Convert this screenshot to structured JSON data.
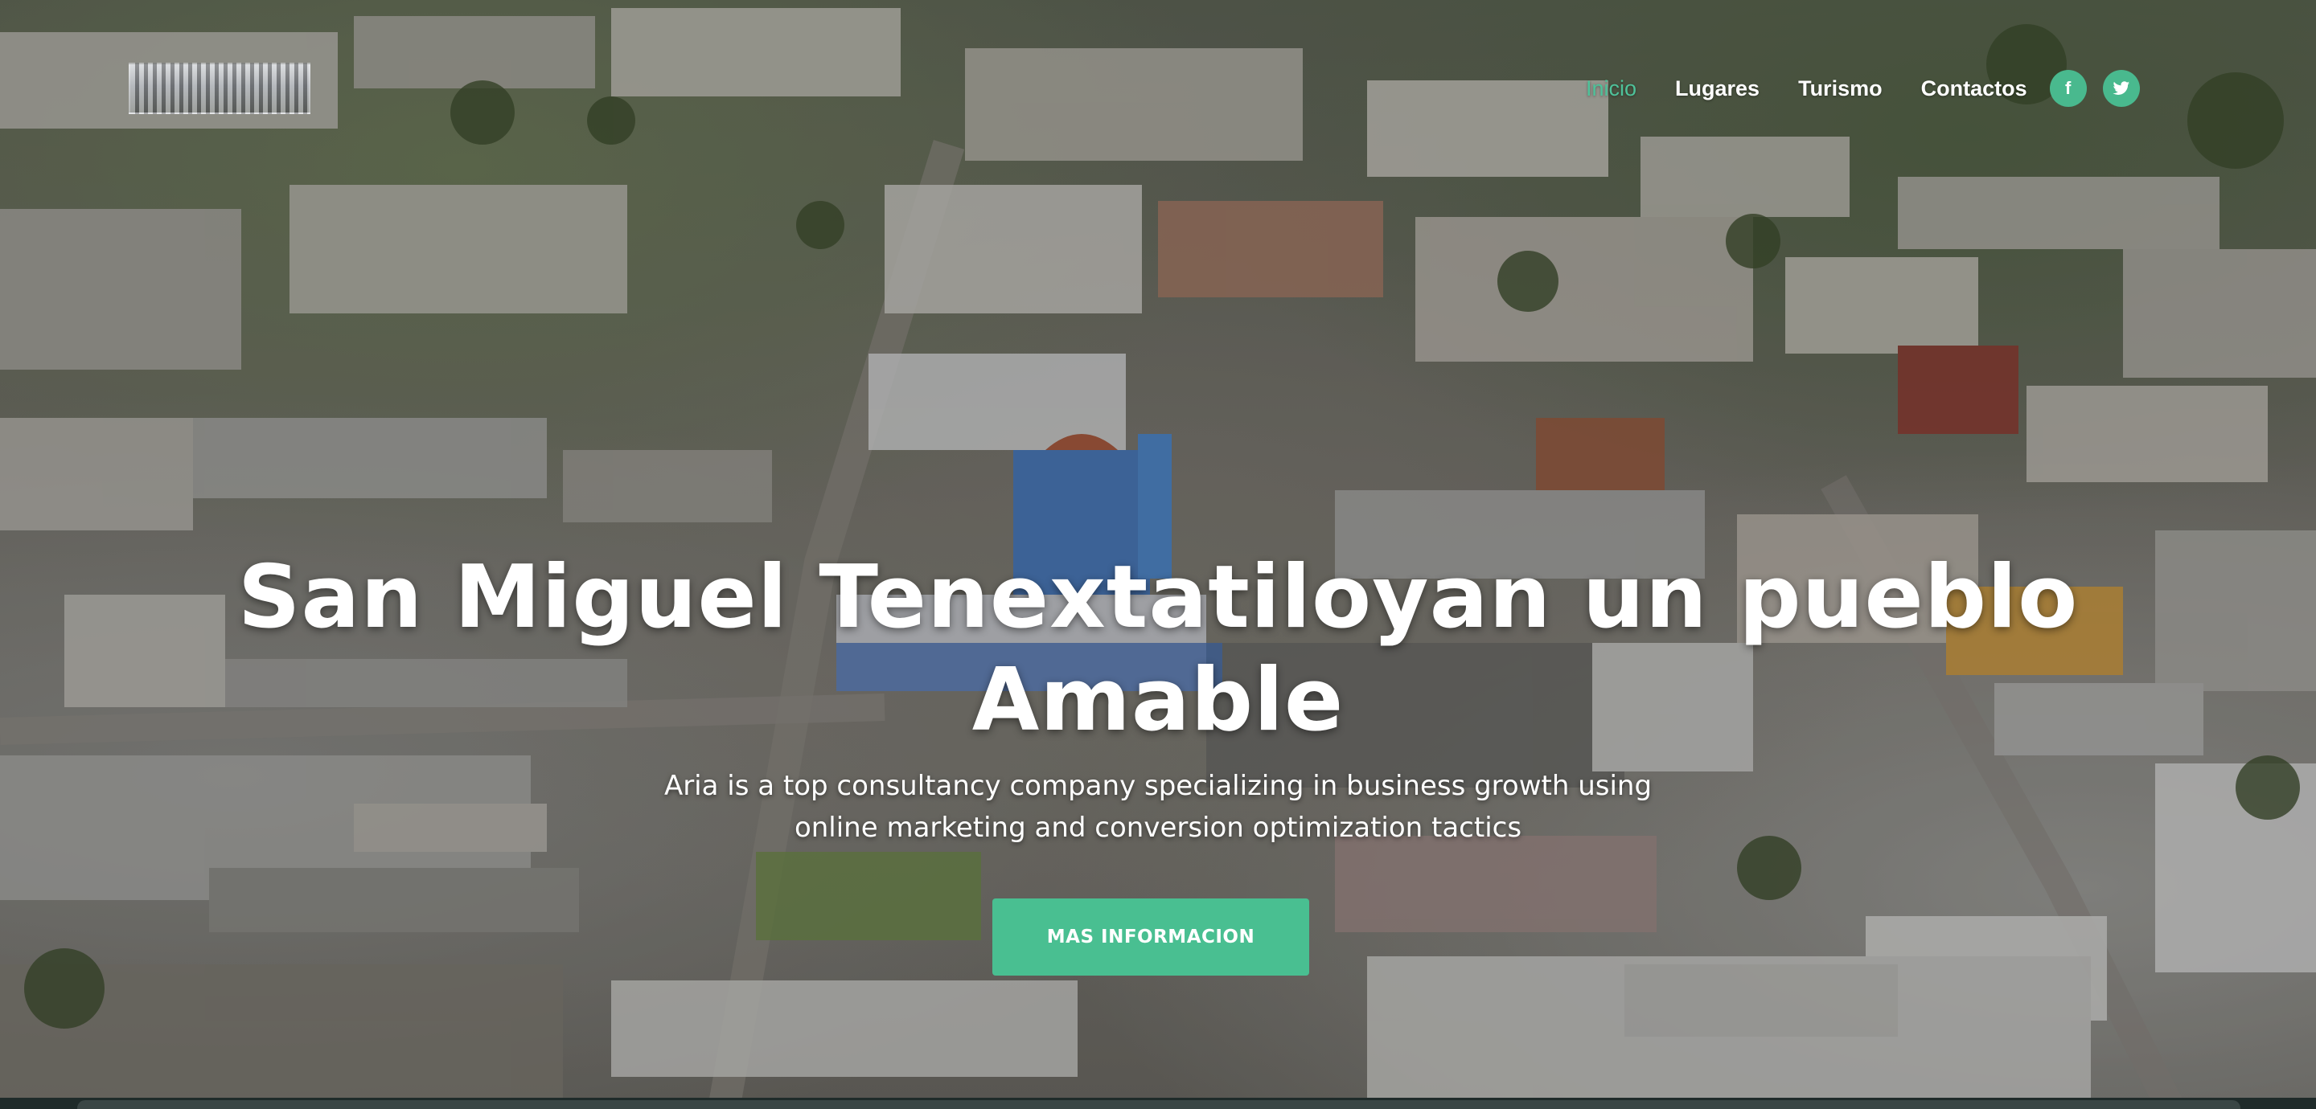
{
  "nav": {
    "items": [
      {
        "label": "Inicio",
        "active": true
      },
      {
        "label": "Lugares",
        "active": false
      },
      {
        "label": "Turismo",
        "active": false
      },
      {
        "label": "Contactos",
        "active": false
      }
    ],
    "social": [
      {
        "icon": "facebook-icon",
        "glyph": "f"
      },
      {
        "icon": "twitter-icon",
        "glyph": ""
      }
    ]
  },
  "hero": {
    "title_line1": "San Miguel Tenextatiloyan un pueblo",
    "title_line2": "Amable",
    "subtitle_line1": "Aria is a top consultancy company specializing in business growth using",
    "subtitle_line2": "online marketing and conversion optimization tactics",
    "cta_label": "MAS INFORMACION"
  },
  "colors": {
    "accent": "#49bf91",
    "active_link": "#4ec29a",
    "text": "#ffffff"
  }
}
